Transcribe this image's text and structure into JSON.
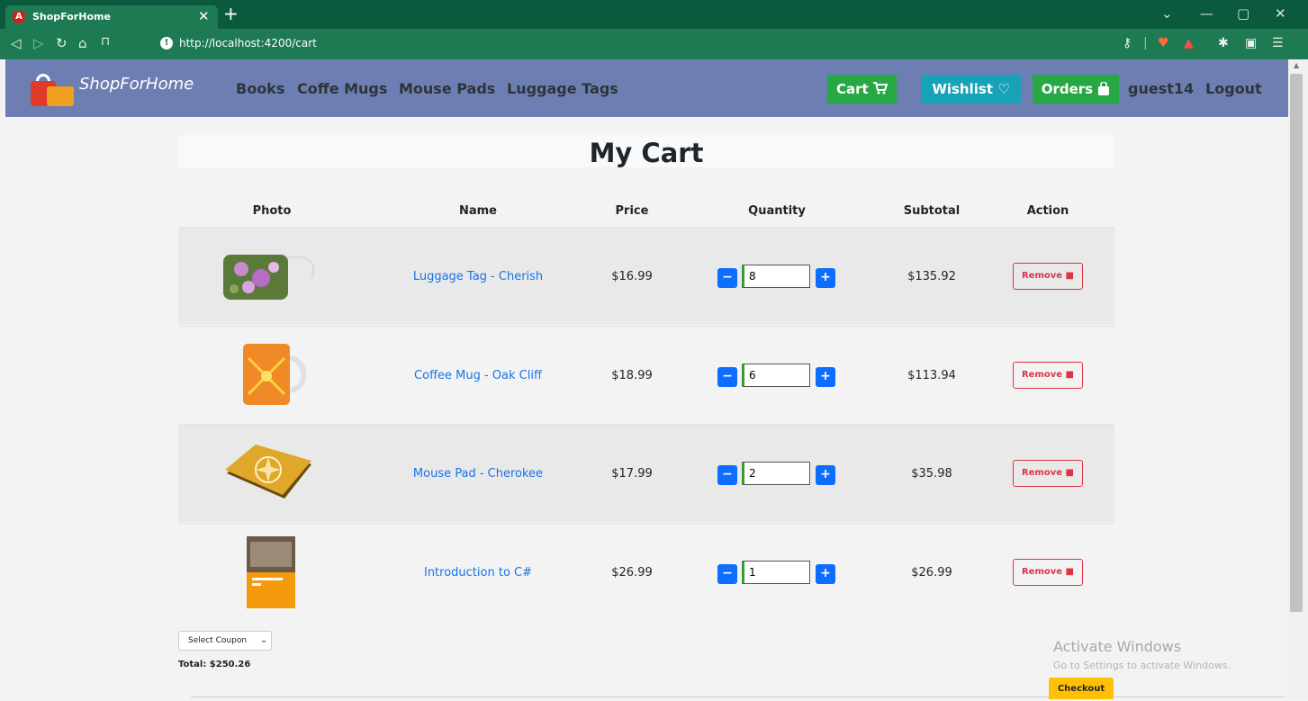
{
  "browser": {
    "tab_title": "ShopForHome",
    "tab_favicon": "A",
    "url": "http://localhost:4200/cart"
  },
  "navbar": {
    "brand": "ShopForHome",
    "links": [
      "Books",
      "Coffe Mugs",
      "Mouse Pads",
      "Luggage Tags"
    ],
    "cart_label": "Cart",
    "wishlist_label": "Wishlist",
    "orders_label": "Orders",
    "user": "guest14",
    "logout_label": "Logout",
    "colors": {
      "navbar": "#6d7fb2",
      "cart": "#28a745",
      "wishlist": "#17a2b8",
      "orders": "#28a745"
    }
  },
  "cart": {
    "title": "My Cart",
    "columns": [
      "Photo",
      "Name",
      "Price",
      "Quantity",
      "Subtotal",
      "Action"
    ],
    "items": [
      {
        "name": "Luggage Tag - Cherish",
        "price": "$16.99",
        "quantity": "8",
        "subtotal": "$135.92",
        "remove_label": "Remove",
        "image": "luggage-tag-image"
      },
      {
        "name": "Coffee Mug - Oak Cliff",
        "price": "$18.99",
        "quantity": "6",
        "subtotal": "$113.94",
        "remove_label": "Remove",
        "image": "coffee-mug-image"
      },
      {
        "name": "Mouse Pad - Cherokee",
        "price": "$17.99",
        "quantity": "2",
        "subtotal": "$35.98",
        "remove_label": "Remove",
        "image": "mouse-pad-image"
      },
      {
        "name": "Introduction to C#",
        "price": "$26.99",
        "quantity": "1",
        "subtotal": "$26.99",
        "remove_label": "Remove",
        "image": "book-cover-image"
      }
    ],
    "minus_symbol": "−",
    "plus_symbol": "+",
    "coupon_select": "Select Coupon",
    "total": "Total: $250.26",
    "checkout_label": "Checkout"
  },
  "windows_notice": {
    "title": "Activate Windows",
    "subtitle": "Go to Settings to activate Windows."
  }
}
